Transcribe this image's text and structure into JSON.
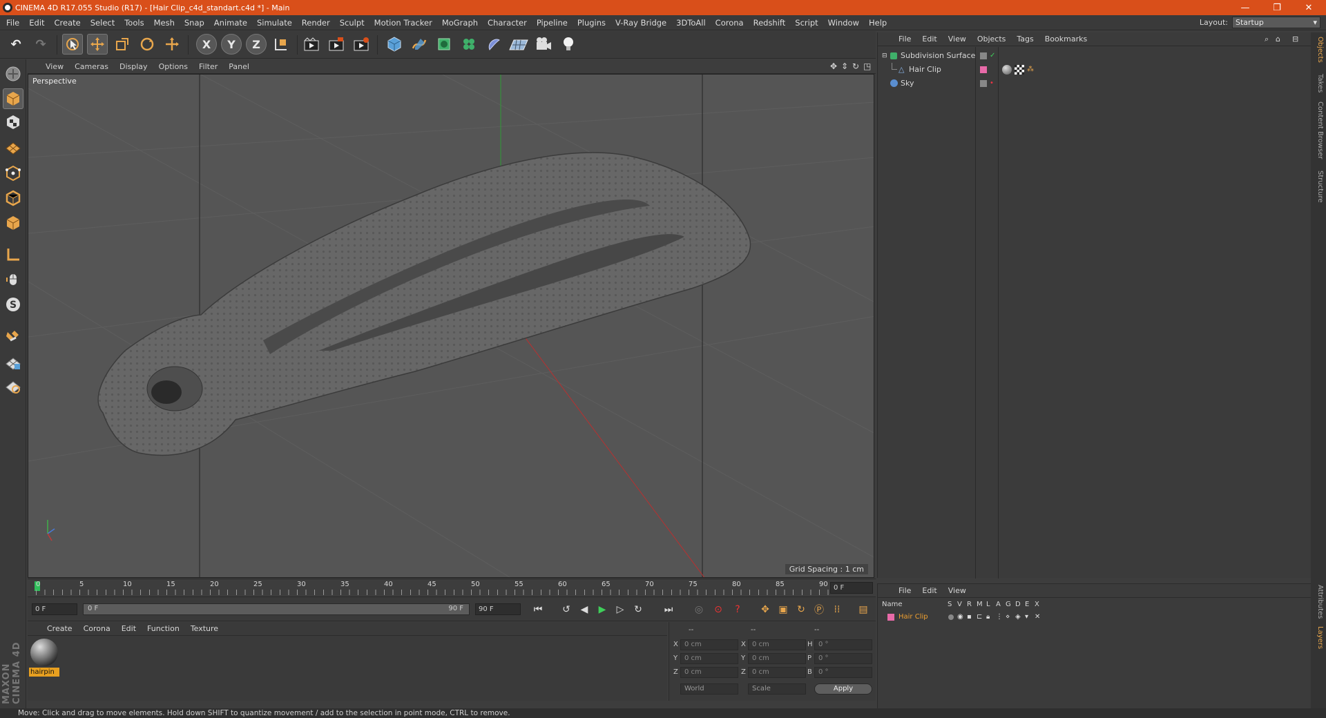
{
  "window": {
    "title": "CINEMA 4D R17.055 Studio (R17) - [Hair Clip_c4d_standart.c4d *] - Main",
    "minimize": "—",
    "restore": "❐",
    "close": "✕"
  },
  "menubar": {
    "items": [
      "File",
      "Edit",
      "Create",
      "Select",
      "Tools",
      "Mesh",
      "Snap",
      "Animate",
      "Simulate",
      "Render",
      "Sculpt",
      "Motion Tracker",
      "MoGraph",
      "Character",
      "Pipeline",
      "Plugins",
      "V-Ray Bridge",
      "3DToAll",
      "Corona",
      "Redshift",
      "Script",
      "Window",
      "Help"
    ],
    "layout_label": "Layout:",
    "layout_value": "Startup"
  },
  "toolbar": {
    "x_label": "X",
    "y_label": "Y",
    "z_label": "Z"
  },
  "viewport": {
    "menu": [
      "View",
      "Cameras",
      "Display",
      "Options",
      "Filter",
      "Panel"
    ],
    "label": "Perspective",
    "grid_spacing": "Grid Spacing : 1 cm"
  },
  "timeline": {
    "ticks": [
      "0",
      "5",
      "10",
      "15",
      "20",
      "25",
      "30",
      "35",
      "40",
      "45",
      "50",
      "55",
      "60",
      "65",
      "70",
      "75",
      "80",
      "85",
      "90"
    ],
    "current_frame": "0 F",
    "start_field": "0 F",
    "slider_start": "0 F",
    "slider_end": "90 F",
    "end_field": "90 F"
  },
  "materials": {
    "menu": [
      "Create",
      "Corona",
      "Edit",
      "Function",
      "Texture"
    ],
    "items": [
      {
        "name": "hairpin"
      }
    ]
  },
  "coordinates": {
    "headers": [
      "--",
      "--",
      "--"
    ],
    "rows": [
      {
        "a": "X",
        "av": "0 cm",
        "b": "X",
        "bv": "0 cm",
        "c": "H",
        "cv": "0 °"
      },
      {
        "a": "Y",
        "av": "0 cm",
        "b": "Y",
        "bv": "0 cm",
        "c": "P",
        "cv": "0 °"
      },
      {
        "a": "Z",
        "av": "0 cm",
        "b": "Z",
        "bv": "0 cm",
        "c": "B",
        "cv": "0 °"
      }
    ],
    "space": "World",
    "mode": "Scale",
    "apply": "Apply"
  },
  "objects": {
    "menu": [
      "File",
      "Edit",
      "View",
      "Objects",
      "Tags",
      "Bookmarks"
    ],
    "items": [
      {
        "name": "Subdivision Surface",
        "indent": 0
      },
      {
        "name": "Hair Clip",
        "indent": 1
      },
      {
        "name": "Sky",
        "indent": 0
      }
    ]
  },
  "layers": {
    "menu": [
      "File",
      "Edit",
      "View"
    ],
    "columns": [
      "Name",
      "S",
      "V",
      "R",
      "M",
      "L",
      "A",
      "G",
      "D",
      "E",
      "X"
    ],
    "rows": [
      {
        "name": "Hair Clip",
        "color": "#e86aa8"
      }
    ]
  },
  "right_tabs": [
    "Objects",
    "Takes",
    "Content Browser",
    "Structure",
    "Attributes",
    "Layers"
  ],
  "branding": "MAXON CINEMA 4D",
  "status": "Move: Click and drag to move elements. Hold down SHIFT to quantize movement / add to the selection in point mode, CTRL to remove.",
  "colors": {
    "accent": "#d94f1a",
    "material_label": "#e8a020",
    "layer_name": "#f0a030"
  }
}
